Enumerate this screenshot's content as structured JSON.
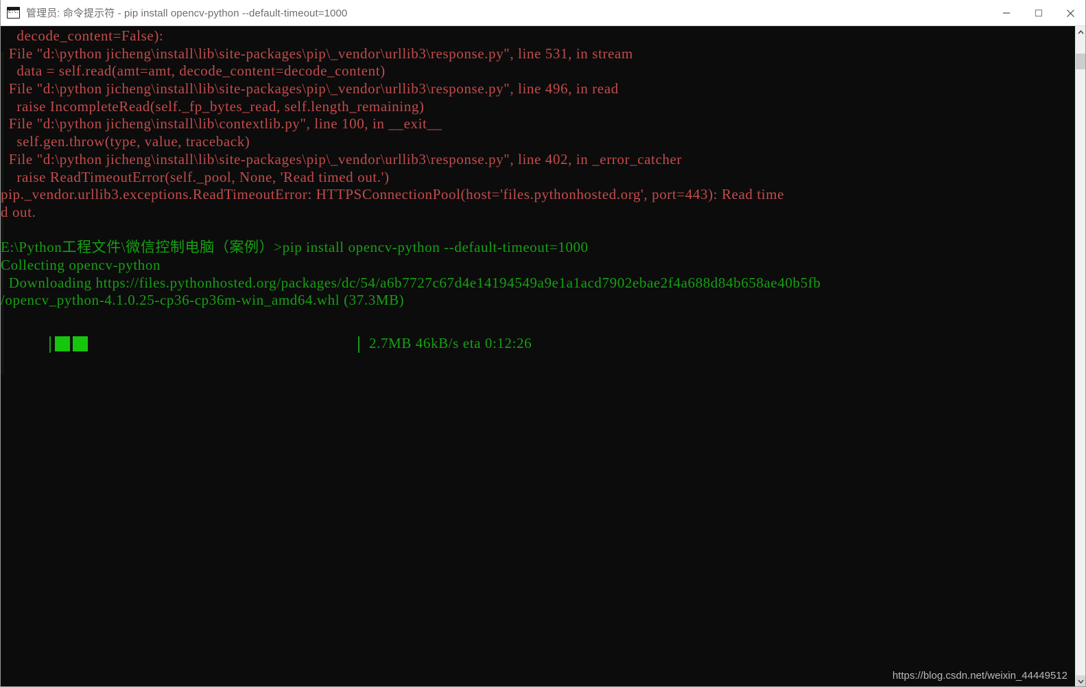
{
  "window": {
    "title": "管理员: 命令提示符 - pip  install opencv-python --default-timeout=1000",
    "icon": "cmd-console-icon",
    "background": "#0c0c0c",
    "titlebar_background": "#ffffff"
  },
  "window_controls": {
    "minimize": "minimize-icon",
    "maximize": "maximize-icon",
    "close": "close-icon"
  },
  "colors": {
    "error_text": "#c44b4b",
    "success_text": "#16a013",
    "progress_fill": "#16c60c",
    "console_bg": "#0c0c0c"
  },
  "console": {
    "lines": [
      {
        "text": "    decode_content=False):",
        "color": "error"
      },
      {
        "text": "  File \"d:\\python jicheng\\install\\lib\\site-packages\\pip\\_vendor\\urllib3\\response.py\", line 531, in stream",
        "color": "error"
      },
      {
        "text": "    data = self.read(amt=amt, decode_content=decode_content)",
        "color": "error"
      },
      {
        "text": "  File \"d:\\python jicheng\\install\\lib\\site-packages\\pip\\_vendor\\urllib3\\response.py\", line 496, in read",
        "color": "error"
      },
      {
        "text": "    raise IncompleteRead(self._fp_bytes_read, self.length_remaining)",
        "color": "error"
      },
      {
        "text": "  File \"d:\\python jicheng\\install\\lib\\contextlib.py\", line 100, in __exit__",
        "color": "error"
      },
      {
        "text": "    self.gen.throw(type, value, traceback)",
        "color": "error"
      },
      {
        "text": "  File \"d:\\python jicheng\\install\\lib\\site-packages\\pip\\_vendor\\urllib3\\response.py\", line 402, in _error_catcher",
        "color": "error"
      },
      {
        "text": "    raise ReadTimeoutError(self._pool, None, 'Read timed out.')",
        "color": "error"
      },
      {
        "text": "pip._vendor.urllib3.exceptions.ReadTimeoutError: HTTPSConnectionPool(host='files.pythonhosted.org', port=443): Read time",
        "color": "error"
      },
      {
        "text": "d out.",
        "color": "error"
      },
      {
        "text": "",
        "color": "error"
      },
      {
        "text": "E:\\Python工程文件\\微信控制电脑（案例）>pip install opencv-python --default-timeout=1000",
        "color": "green"
      },
      {
        "text": "Collecting opencv-python",
        "color": "green"
      },
      {
        "text": "  Downloading https://files.pythonhosted.org/packages/dc/54/a6b7727c67d4e14194549a9e1a1acd7902ebae2f4a688d84b658ae40b5fb",
        "color": "green"
      },
      {
        "text": "/opencv_python-4.1.0.25-cp36-cp36m-win_amd64.whl (37.3MB)",
        "color": "green"
      }
    ]
  },
  "progress": {
    "downloaded": "2.7MB",
    "speed": "46kB/s",
    "eta_label": "eta",
    "eta": "0:12:26",
    "stats_line": "2.7MB 46kB/s eta 0:12:26",
    "blocks_filled": 2,
    "bar_left_marker": "|",
    "bar_right_marker": "|"
  },
  "scrollbar": {
    "up_arrow": "chevron-up-icon",
    "down_arrow": "chevron-down-icon",
    "thumb": "scrollbar-thumb"
  },
  "watermark": {
    "text": "https://blog.csdn.net/weixin_44449512"
  }
}
